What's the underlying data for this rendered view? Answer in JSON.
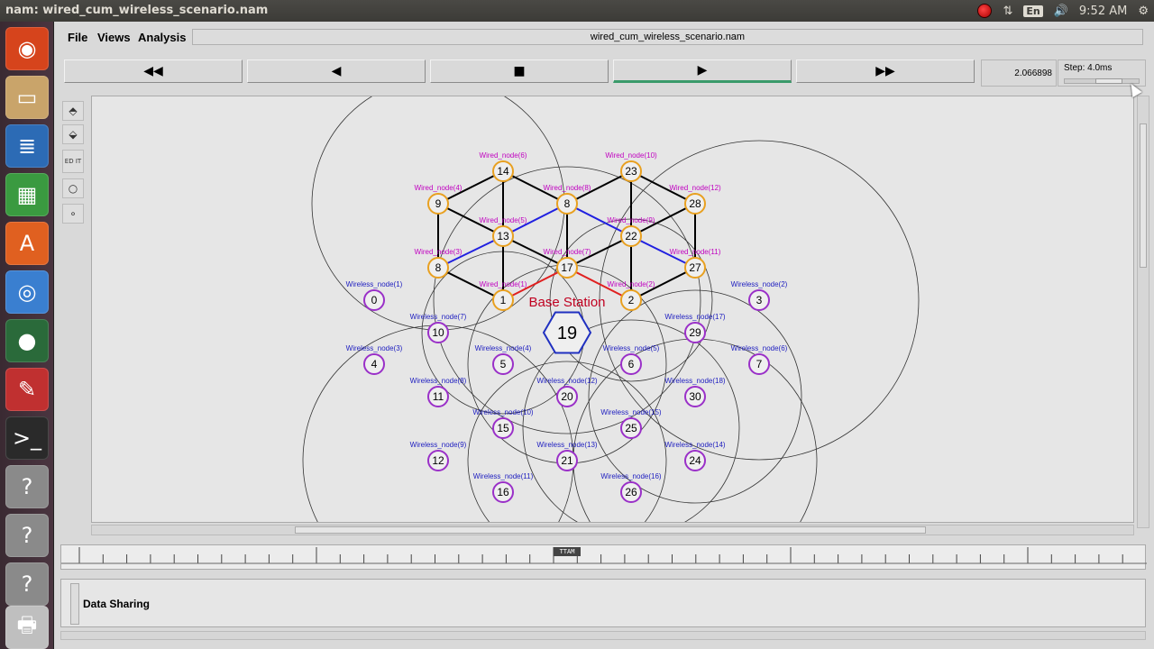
{
  "window_title": "nam: wired_cum_wireless_scenario.nam",
  "tray": {
    "lang": "En",
    "clock": "9:52 AM"
  },
  "menu": {
    "file": "File",
    "views": "Views",
    "analysis": "Analysis"
  },
  "file_title": "wired_cum_wireless_scenario.nam",
  "transport": {
    "rewind": "◀◀",
    "back": "◀",
    "stop": "■",
    "play": "▶",
    "ffwd": "▶▶"
  },
  "time_value": "2.066898",
  "step_label": "Step: 4.0ms",
  "tools": {
    "zoom_in": "⬘",
    "zoom_out": "⬙",
    "edit": "ED IT"
  },
  "annotation": "Data Sharing",
  "time_marker": "TTAM",
  "base_station_label": "Base Station",
  "base_station_id": "19",
  "colors": {
    "wired": "#e8a020",
    "wireless": "#9a30c8",
    "base": "#2030c0",
    "label_wired": "#c000c0",
    "label_wireless": "#2020c0",
    "red_link": "#e02020",
    "blue_link": "#2020e0"
  },
  "wired_nodes": [
    {
      "id": "14",
      "label": "Wired_node(6)"
    },
    {
      "id": "23",
      "label": "Wired_node(10)"
    },
    {
      "id": "9",
      "label": "Wired_node(4)"
    },
    {
      "id": "8",
      "label": "Wired_node(8)"
    },
    {
      "id": "28",
      "label": "Wired_node(12)"
    },
    {
      "id": "13",
      "label": "Wired_node(5)"
    },
    {
      "id": "22",
      "label": "Wired_node(9)"
    },
    {
      "id": "8",
      "label": "Wired_node(3)"
    },
    {
      "id": "17",
      "label": "Wired_node(7)"
    },
    {
      "id": "27",
      "label": "Wired_node(11)"
    },
    {
      "id": "1",
      "label": "Wired_node(1)"
    },
    {
      "id": "2",
      "label": "Wired_node(2)"
    }
  ],
  "wireless_nodes": [
    {
      "id": "0",
      "label": "Wireless_node(1)"
    },
    {
      "id": "3",
      "label": "Wireless_node(2)"
    },
    {
      "id": "10",
      "label": "Wireless_node(7)"
    },
    {
      "id": "29",
      "label": "Wireless_node(17)"
    },
    {
      "id": "4",
      "label": "Wireless_node(3)"
    },
    {
      "id": "5",
      "label": "Wireless_node(4)"
    },
    {
      "id": "6",
      "label": "Wireless_node(5)"
    },
    {
      "id": "7",
      "label": "Wireless_node(6)"
    },
    {
      "id": "11",
      "label": "Wireless_node(8)"
    },
    {
      "id": "20",
      "label": "Wireless_node(12)"
    },
    {
      "id": "30",
      "label": "Wireless_node(18)"
    },
    {
      "id": "15",
      "label": "Wireless_node(10)"
    },
    {
      "id": "25",
      "label": "Wireless_node(15)"
    },
    {
      "id": "12",
      "label": "Wireless_node(9)"
    },
    {
      "id": "21",
      "label": "Wireless_node(13)"
    },
    {
      "id": "24",
      "label": "Wireless_node(14)"
    },
    {
      "id": "16",
      "label": "Wireless_node(11)"
    },
    {
      "id": "26",
      "label": "Wireless_node(16)"
    }
  ]
}
